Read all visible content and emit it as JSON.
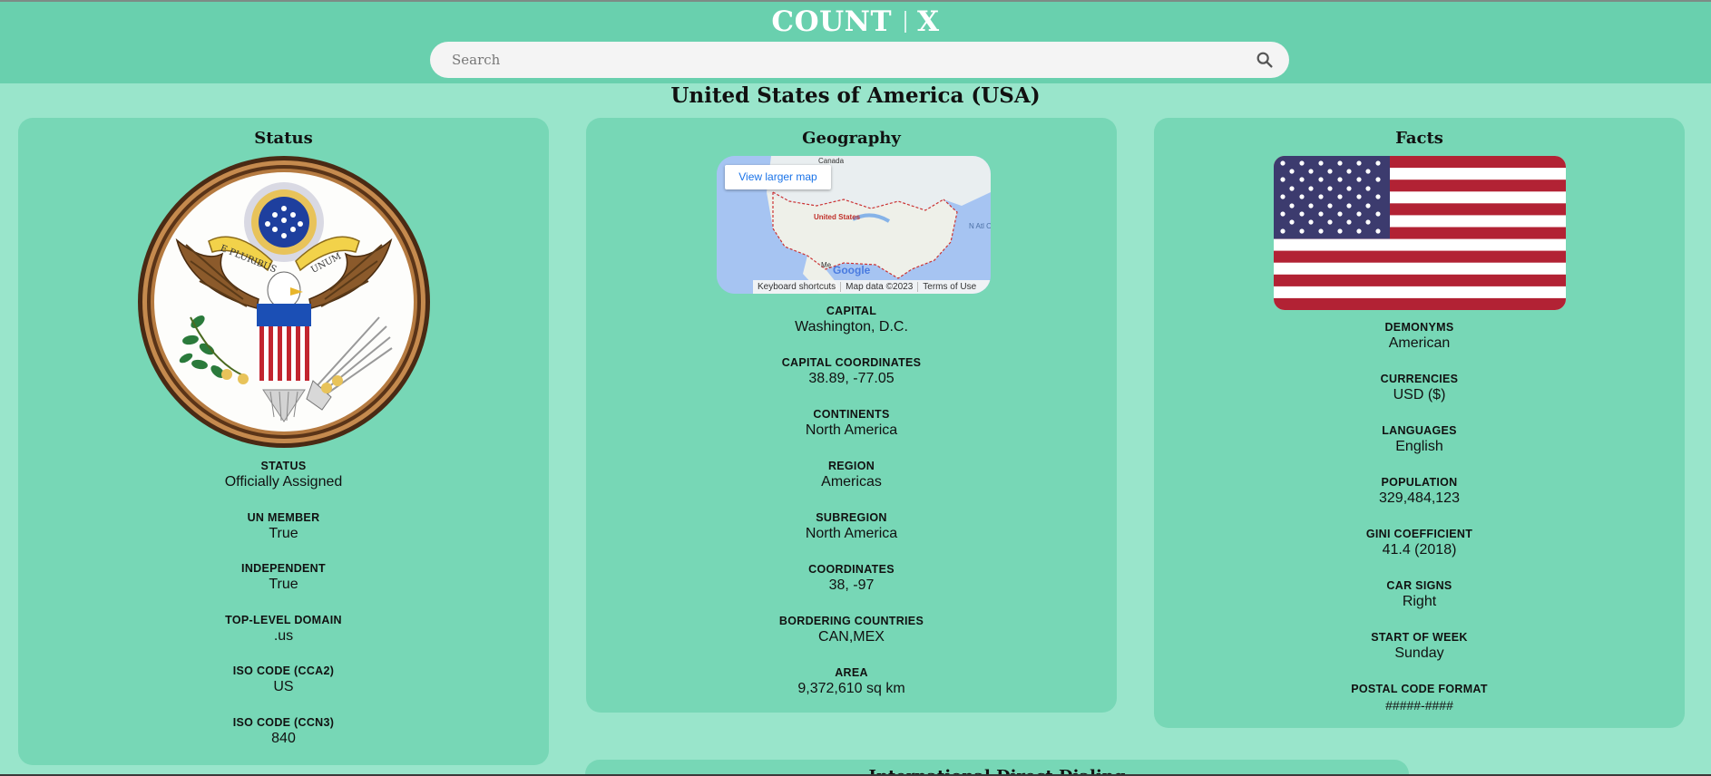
{
  "app": {
    "logo_left": "COUNT",
    "logo_right": "X"
  },
  "search": {
    "placeholder": "Search",
    "value": ""
  },
  "country": {
    "title": "United States of America (USA)"
  },
  "status_card": {
    "title": "Status",
    "fields": [
      {
        "label": "STATUS",
        "value": "Officially Assigned"
      },
      {
        "label": "UN MEMBER",
        "value": "True"
      },
      {
        "label": "INDEPENDENT",
        "value": "True"
      },
      {
        "label": "TOP-LEVEL DOMAIN",
        "value": ".us"
      },
      {
        "label": "ISO CODE (CCA2)",
        "value": "US"
      },
      {
        "label": "ISO CODE (CCN3)",
        "value": "840"
      }
    ]
  },
  "geography_card": {
    "title": "Geography",
    "map": {
      "button": "View larger map",
      "label_canada": "Canada",
      "label_usa": "United States",
      "label_mexico": "Me",
      "label_ocean": "N Atl Oc",
      "google": "Google",
      "footer": [
        "Keyboard shortcuts",
        "Map data ©2023",
        "Terms of Use"
      ]
    },
    "fields": [
      {
        "label": "CAPITAL",
        "value": "Washington, D.C."
      },
      {
        "label": "CAPITAL COORDINATES",
        "value": "38.89, -77.05"
      },
      {
        "label": "CONTINENTS",
        "value": "North America"
      },
      {
        "label": "REGION",
        "value": "Americas"
      },
      {
        "label": "SUBREGION",
        "value": "North America"
      },
      {
        "label": "COORDINATES",
        "value": "38, -97"
      },
      {
        "label": "BORDERING COUNTRIES",
        "value": "CAN,MEX"
      },
      {
        "label": "AREA",
        "value": "9,372,610 sq km"
      }
    ]
  },
  "facts_card": {
    "title": "Facts",
    "fields": [
      {
        "label": "DEMONYMS",
        "value": "American"
      },
      {
        "label": "CURRENCIES",
        "value": "USD ($)"
      },
      {
        "label": "LANGUAGES",
        "value": "English"
      },
      {
        "label": "POPULATION",
        "value": "329,484,123"
      },
      {
        "label": "GINI COEFFICIENT",
        "value": "41.4 (2018)"
      },
      {
        "label": "CAR SIGNS",
        "value": "Right"
      },
      {
        "label": "START OF WEEK",
        "value": "Sunday"
      },
      {
        "label": "POSTAL CODE FORMAT",
        "value": "#####-####"
      }
    ]
  },
  "bottom_card": {
    "title": "International Direct Dialing"
  },
  "seal_text": {
    "left": "E PLURIBUS",
    "right": "UNUM"
  },
  "colors": {
    "header": "#69d0ae",
    "background": "#99e5cb",
    "card": "#77d7b6"
  }
}
